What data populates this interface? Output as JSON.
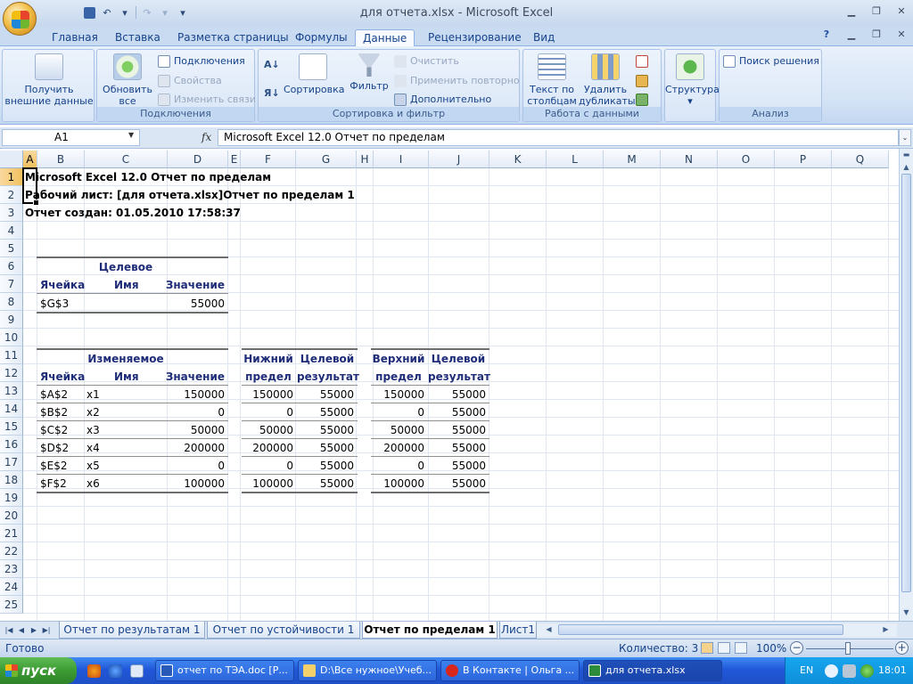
{
  "window": {
    "title": "для отчета.xlsx - Microsoft Excel"
  },
  "qat": {
    "save": "save-icon",
    "undo": "↶",
    "redo": "↷",
    "customize": "▾"
  },
  "ribbon_tabs": [
    "Главная",
    "Вставка",
    "Разметка страницы",
    "Формулы",
    "Данные",
    "Рецензирование",
    "Вид"
  ],
  "ribbon": {
    "get_external": [
      "Получить",
      "внешние данные"
    ],
    "refresh": [
      "Обновить",
      "все"
    ],
    "connections": "Подключения",
    "properties": "Свойства",
    "edit_links": "Изменить связи",
    "group_connections": "Подключения",
    "sort": "Сортировка",
    "filter": "Фильтр",
    "clear": "Очистить",
    "reapply": "Применить повторно",
    "advanced": "Дополнительно",
    "group_sort": "Сортировка и фильтр",
    "text_to_cols": [
      "Текст по",
      "столбцам"
    ],
    "remove_dups": [
      "Удалить",
      "дубликаты"
    ],
    "group_data_tools": "Работа с данными",
    "outline": "Структура",
    "solver": "Поиск решения",
    "group_analysis": "Анализ"
  },
  "formula_bar": {
    "name_box": "A1",
    "fx": "fx",
    "content": "Microsoft Excel 12.0 Отчет по пределам"
  },
  "columns": [
    "A",
    "B",
    "C",
    "D",
    "E",
    "F",
    "G",
    "H",
    "I",
    "J",
    "K",
    "L",
    "M",
    "N",
    "O",
    "P",
    "Q"
  ],
  "rows": [
    "1",
    "2",
    "3",
    "4",
    "5",
    "6",
    "7",
    "8",
    "9",
    "10",
    "11",
    "12",
    "13",
    "14",
    "15",
    "16",
    "17",
    "18",
    "19",
    "20",
    "21",
    "22",
    "23",
    "24",
    "25"
  ],
  "sheet": {
    "r1": "Microsoft Excel 12.0 Отчет по пределам",
    "r2": "Рабочий лист: [для отчета.xlsx]Отчет по пределам 1",
    "r3": "Отчет создан: 01.05.2010 17:58:37",
    "target": {
      "title": "Целевое",
      "h_cell": "Ячейка",
      "h_name": "Имя",
      "h_value": "Значение",
      "cell": "$G$3",
      "value": "55000"
    },
    "variables": {
      "title": "Изменяемое",
      "h_cell": "Ячейка",
      "h_name": "Имя",
      "h_value": "Значение",
      "lower_title": [
        "Нижний",
        "предел"
      ],
      "upper_title": [
        "Верхний",
        "предел"
      ],
      "result_title": [
        "Целевой",
        "результат"
      ],
      "rows": [
        {
          "cell": "$A$2",
          "name": "x1",
          "value": "150000",
          "lower": "150000",
          "lres": "55000",
          "upper": "150000",
          "ures": "55000"
        },
        {
          "cell": "$B$2",
          "name": "x2",
          "value": "0",
          "lower": "0",
          "lres": "55000",
          "upper": "0",
          "ures": "55000"
        },
        {
          "cell": "$C$2",
          "name": "x3",
          "value": "50000",
          "lower": "50000",
          "lres": "55000",
          "upper": "50000",
          "ures": "55000"
        },
        {
          "cell": "$D$2",
          "name": "x4",
          "value": "200000",
          "lower": "200000",
          "lres": "55000",
          "upper": "200000",
          "ures": "55000"
        },
        {
          "cell": "$E$2",
          "name": "x5",
          "value": "0",
          "lower": "0",
          "lres": "55000",
          "upper": "0",
          "ures": "55000"
        },
        {
          "cell": "$F$2",
          "name": "x6",
          "value": "100000",
          "lower": "100000",
          "lres": "55000",
          "upper": "100000",
          "ures": "55000"
        }
      ]
    }
  },
  "sheet_tabs": [
    "Отчет по результатам 1",
    "Отчет по устойчивости 1",
    "Отчет по пределам 1",
    "Лист1"
  ],
  "status": {
    "ready": "Готово",
    "count": "Количество: 3",
    "zoom": "100%",
    "zoom_minus": "−",
    "zoom_plus": "+"
  },
  "taskbar": {
    "start": "пуск",
    "items": [
      "отчет по ТЭА.doc [Р...",
      "D:\\Все нужное\\Учеб...",
      "В Контакте | Ольга ...",
      "для отчета.xlsx"
    ],
    "lang": "EN",
    "time": "18:01"
  }
}
